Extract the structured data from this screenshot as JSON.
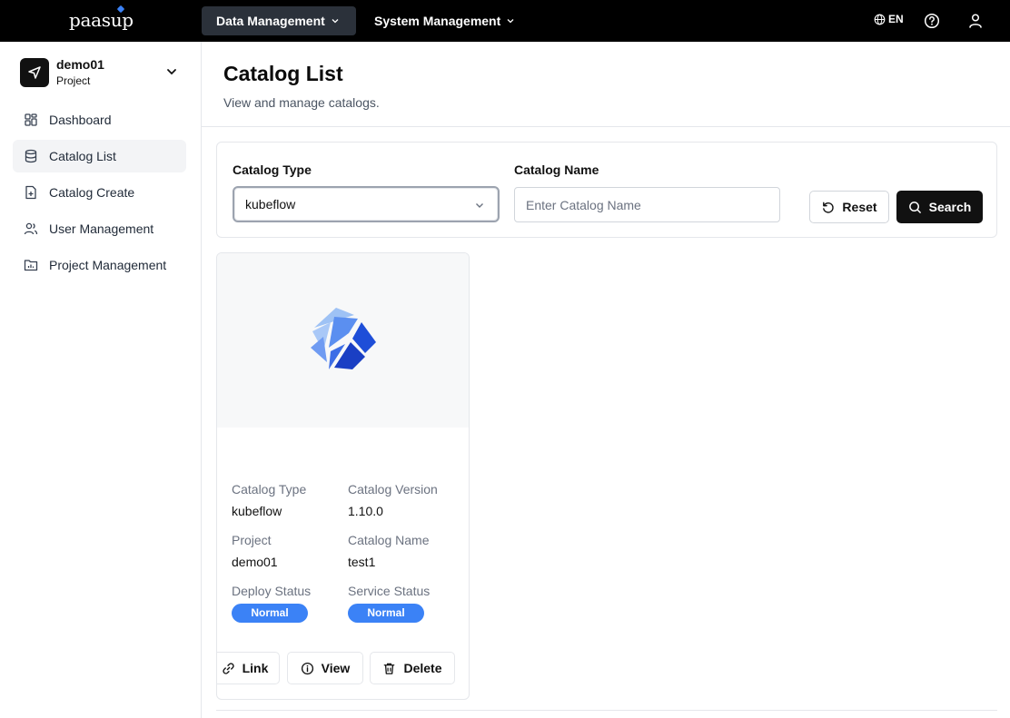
{
  "brand": {
    "logo_text": "paasup",
    "accent": "#3b82f6"
  },
  "topnav": {
    "items": [
      {
        "label": "Data Management",
        "active": true
      },
      {
        "label": "System Management",
        "active": false
      }
    ],
    "language": "EN"
  },
  "sidebar": {
    "project": {
      "name": "demo01",
      "type": "Project"
    },
    "items": [
      {
        "label": "Dashboard",
        "icon": "dashboard-icon",
        "active": false
      },
      {
        "label": "Catalog List",
        "icon": "database-icon",
        "active": true
      },
      {
        "label": "Catalog Create",
        "icon": "file-plus-icon",
        "active": false
      },
      {
        "label": "User Management",
        "icon": "users-icon",
        "active": false
      },
      {
        "label": "Project Management",
        "icon": "folder-chart-icon",
        "active": false
      }
    ]
  },
  "page": {
    "title": "Catalog List",
    "subtitle": "View and manage catalogs."
  },
  "filter": {
    "type_label": "Catalog Type",
    "type_value": "kubeflow",
    "name_label": "Catalog Name",
    "name_placeholder": "Enter Catalog Name",
    "name_value": "",
    "reset_label": "Reset",
    "search_label": "Search"
  },
  "cards": [
    {
      "logo": "kubeflow-logo",
      "fields": {
        "catalog_type_label": "Catalog Type",
        "catalog_type": "kubeflow",
        "catalog_version_label": "Catalog Version",
        "catalog_version": "1.10.0",
        "project_label": "Project",
        "project": "demo01",
        "catalog_name_label": "Catalog Name",
        "catalog_name": "test1",
        "deploy_status_label": "Deploy Status",
        "deploy_status": "Normal",
        "service_status_label": "Service Status",
        "service_status": "Normal"
      },
      "actions": {
        "link": "Link",
        "view": "View",
        "delete": "Delete"
      },
      "status_color": "#3b82f6"
    }
  ]
}
